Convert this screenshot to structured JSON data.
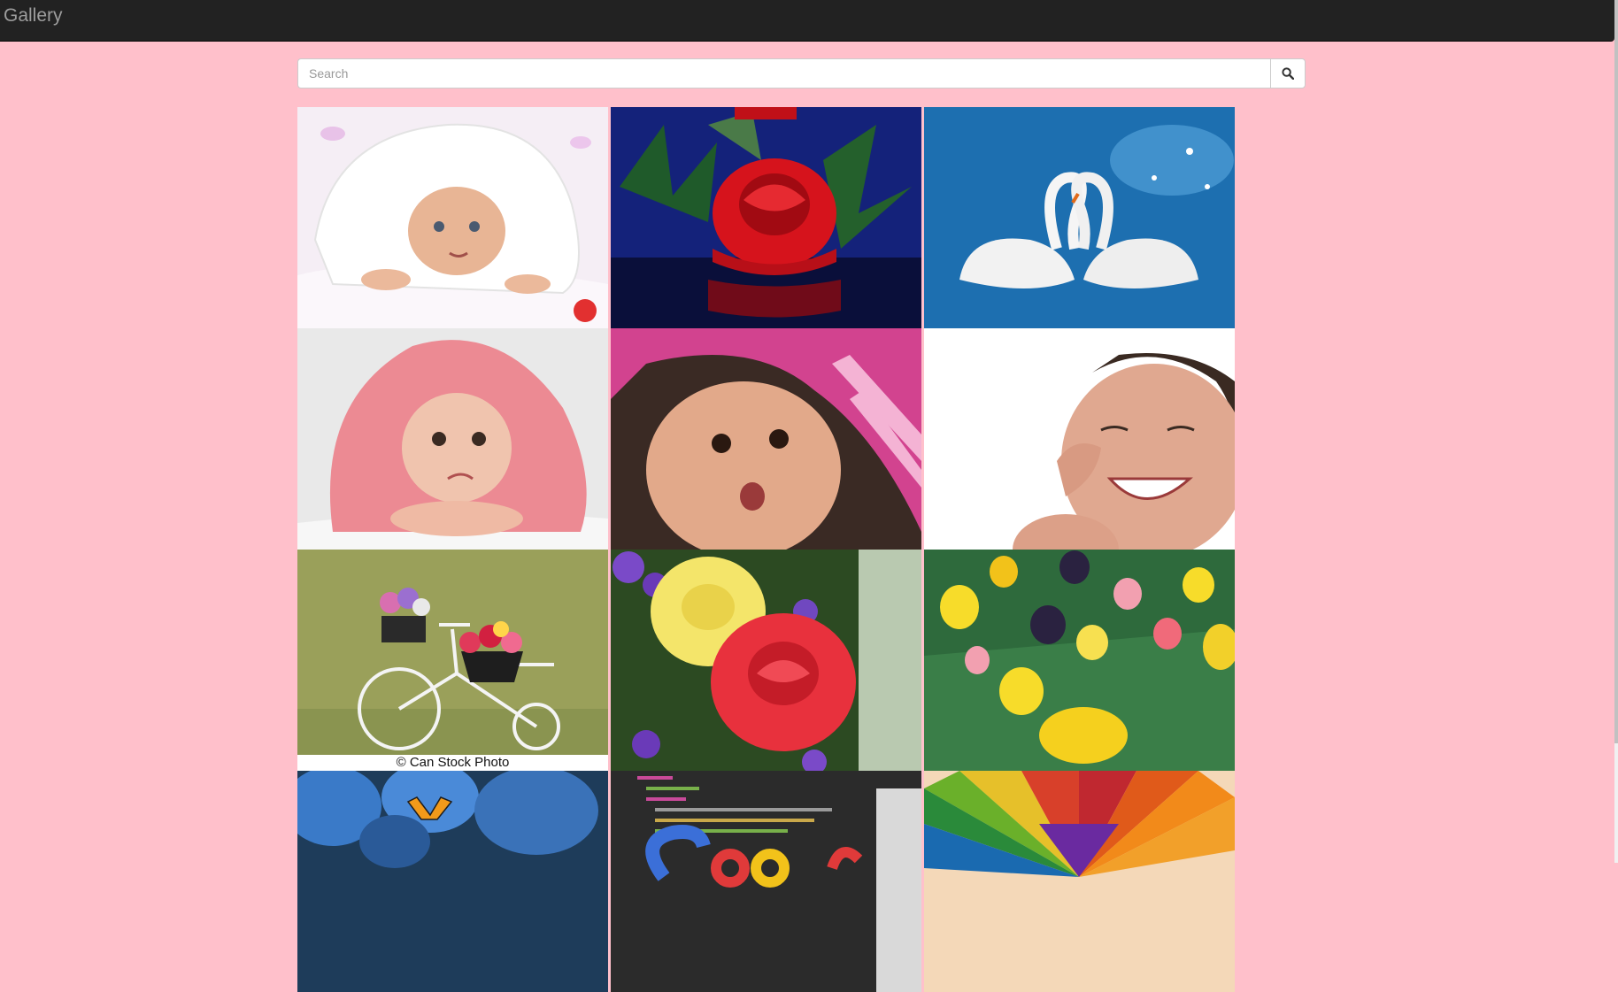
{
  "navbar": {
    "brand": "Gallery",
    "background": "#222222",
    "brand_color": "#9d9d9d"
  },
  "search": {
    "placeholder": "Search",
    "value": "",
    "button_icon": "search-icon"
  },
  "page_background": "#ffc0cb",
  "gallery": [
    {
      "name": "baby-white-towel-photo"
    },
    {
      "name": "red-rose-water-photo"
    },
    {
      "name": "swans-photo"
    },
    {
      "name": "baby-pink-towel-photo"
    },
    {
      "name": "baby-pink-blanket-photo"
    },
    {
      "name": "laughing-baby-photo"
    },
    {
      "name": "flower-bicycle-photo",
      "caption": "© Can Stock Photo"
    },
    {
      "name": "yellow-red-roses-photo"
    },
    {
      "name": "tulips-photo"
    },
    {
      "name": "butterfly-stones-photo"
    },
    {
      "name": "code-screen-photo"
    },
    {
      "name": "colored-pencils-photo"
    }
  ]
}
